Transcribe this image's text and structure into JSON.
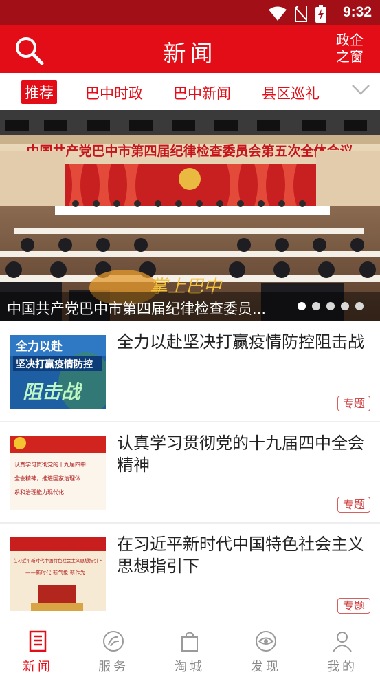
{
  "status": {
    "time": "9:32"
  },
  "header": {
    "title": "新闻",
    "portal_label": "政企之窗"
  },
  "tabs": [
    {
      "label": "推荐",
      "active": true
    },
    {
      "label": "巴中时政",
      "active": false
    },
    {
      "label": "巴中新闻",
      "active": false
    },
    {
      "label": "县区巡礼",
      "active": false
    }
  ],
  "banner": {
    "caption": "中国共产党巴中市第四届纪律检查委员...",
    "backdrop_text": "中国共产党巴中市第四届纪律检查委员会第五次全体会议",
    "watermark_text": "掌上巴中",
    "total_slides": 5,
    "active_slide": 1
  },
  "news": [
    {
      "headline": "全力以赴坚决打赢疫情防控阻击战",
      "tag": "专题",
      "thumb_text": [
        "全力以赴",
        "坚决打赢疫情防控",
        "阻击战"
      ]
    },
    {
      "headline": "认真学习贯彻党的十九届四中全会精神",
      "tag": "专题",
      "thumb_text": [
        "认真学习贯彻党的十九届四中",
        "全会精神，推进国家治理体",
        "系和治理能力现代化"
      ]
    },
    {
      "headline": "在习近平新时代中国特色社会主义思想指引下",
      "tag": "专题",
      "thumb_text": [
        "在习近平新时代中国特色社会主义思想指引下",
        "——新时代 新气象 新作为"
      ]
    }
  ],
  "bottom_nav": [
    {
      "label": "新闻",
      "icon": "news-icon",
      "active": true
    },
    {
      "label": "服务",
      "icon": "service-icon",
      "active": false
    },
    {
      "label": "淘城",
      "icon": "shopping-bag-icon",
      "active": false
    },
    {
      "label": "发现",
      "icon": "discover-eye-icon",
      "active": false
    },
    {
      "label": "我的",
      "icon": "user-icon",
      "active": false
    }
  ],
  "colors": {
    "brand_red": "#e30d17",
    "status_bar": "#a30f16",
    "nav_inactive": "#8a8a8a"
  }
}
